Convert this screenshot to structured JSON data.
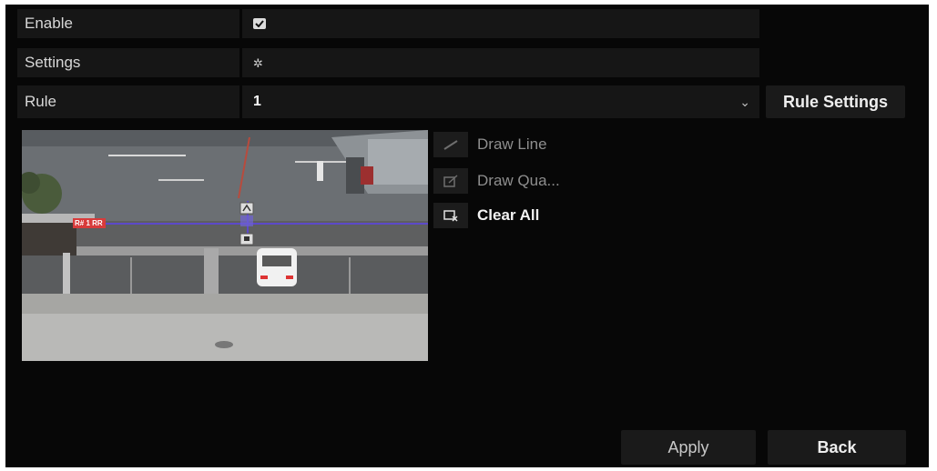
{
  "settings": {
    "enable_label": "Enable",
    "enable_checked": true,
    "settings_label": "Settings",
    "settings_icon": "gear-icon"
  },
  "rule": {
    "label": "Rule",
    "value": "1",
    "settings_button": "Rule Settings"
  },
  "tools": {
    "draw_line": "Draw Line",
    "draw_quadrilateral": "Draw Qua...",
    "clear_all": "Clear All"
  },
  "overlay": {
    "banner_text": "R# 1 RR"
  },
  "footer": {
    "apply": "Apply",
    "back": "Back"
  }
}
